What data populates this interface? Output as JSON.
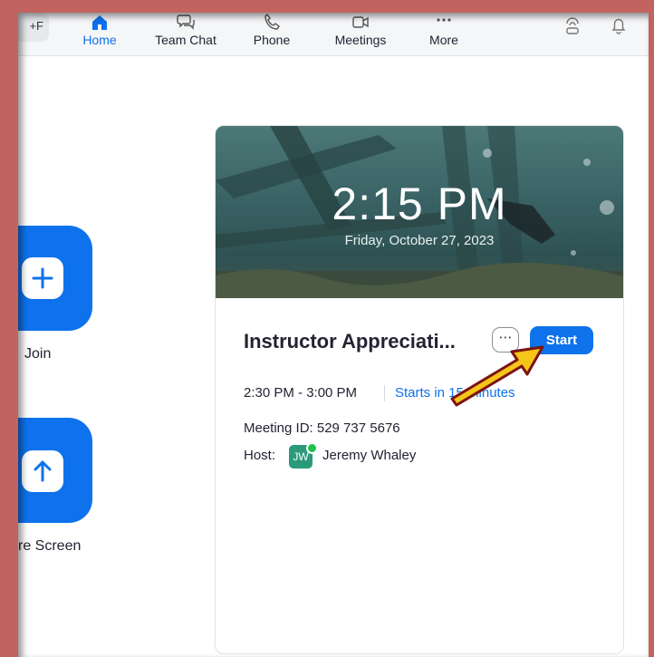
{
  "search": {
    "shortcut_text": "+F"
  },
  "nav": {
    "items": [
      {
        "label": "Home",
        "icon": "home-icon",
        "active": true
      },
      {
        "label": "Team Chat",
        "icon": "chat-icon"
      },
      {
        "label": "Phone",
        "icon": "phone-icon"
      },
      {
        "label": "Meetings",
        "icon": "video-camera-icon"
      },
      {
        "label": "More",
        "icon": "more-dots-icon"
      }
    ],
    "right_icons": [
      "whiteboard-icon",
      "bell-icon"
    ]
  },
  "actions": {
    "join_label": "Join",
    "share_label": "re Screen"
  },
  "card": {
    "clock": "2:15 PM",
    "date": "Friday, October 27, 2023",
    "title": "Instructor Appreciati...",
    "more_label": "⋯",
    "start_label": "Start",
    "time_range": "2:30 PM - 3:00 PM",
    "starts_in": "Starts in 15 minutes",
    "meeting_id": "Meeting ID: 529 737 5676",
    "host_label": "Host:",
    "host_initials": "JW",
    "host_name": "Jeremy Whaley"
  },
  "colors": {
    "accent": "#0e72ed",
    "frame": "#c2635f",
    "arrow_fill": "#f5c518",
    "arrow_outline": "#7a1414",
    "online": "#1fc24a"
  }
}
